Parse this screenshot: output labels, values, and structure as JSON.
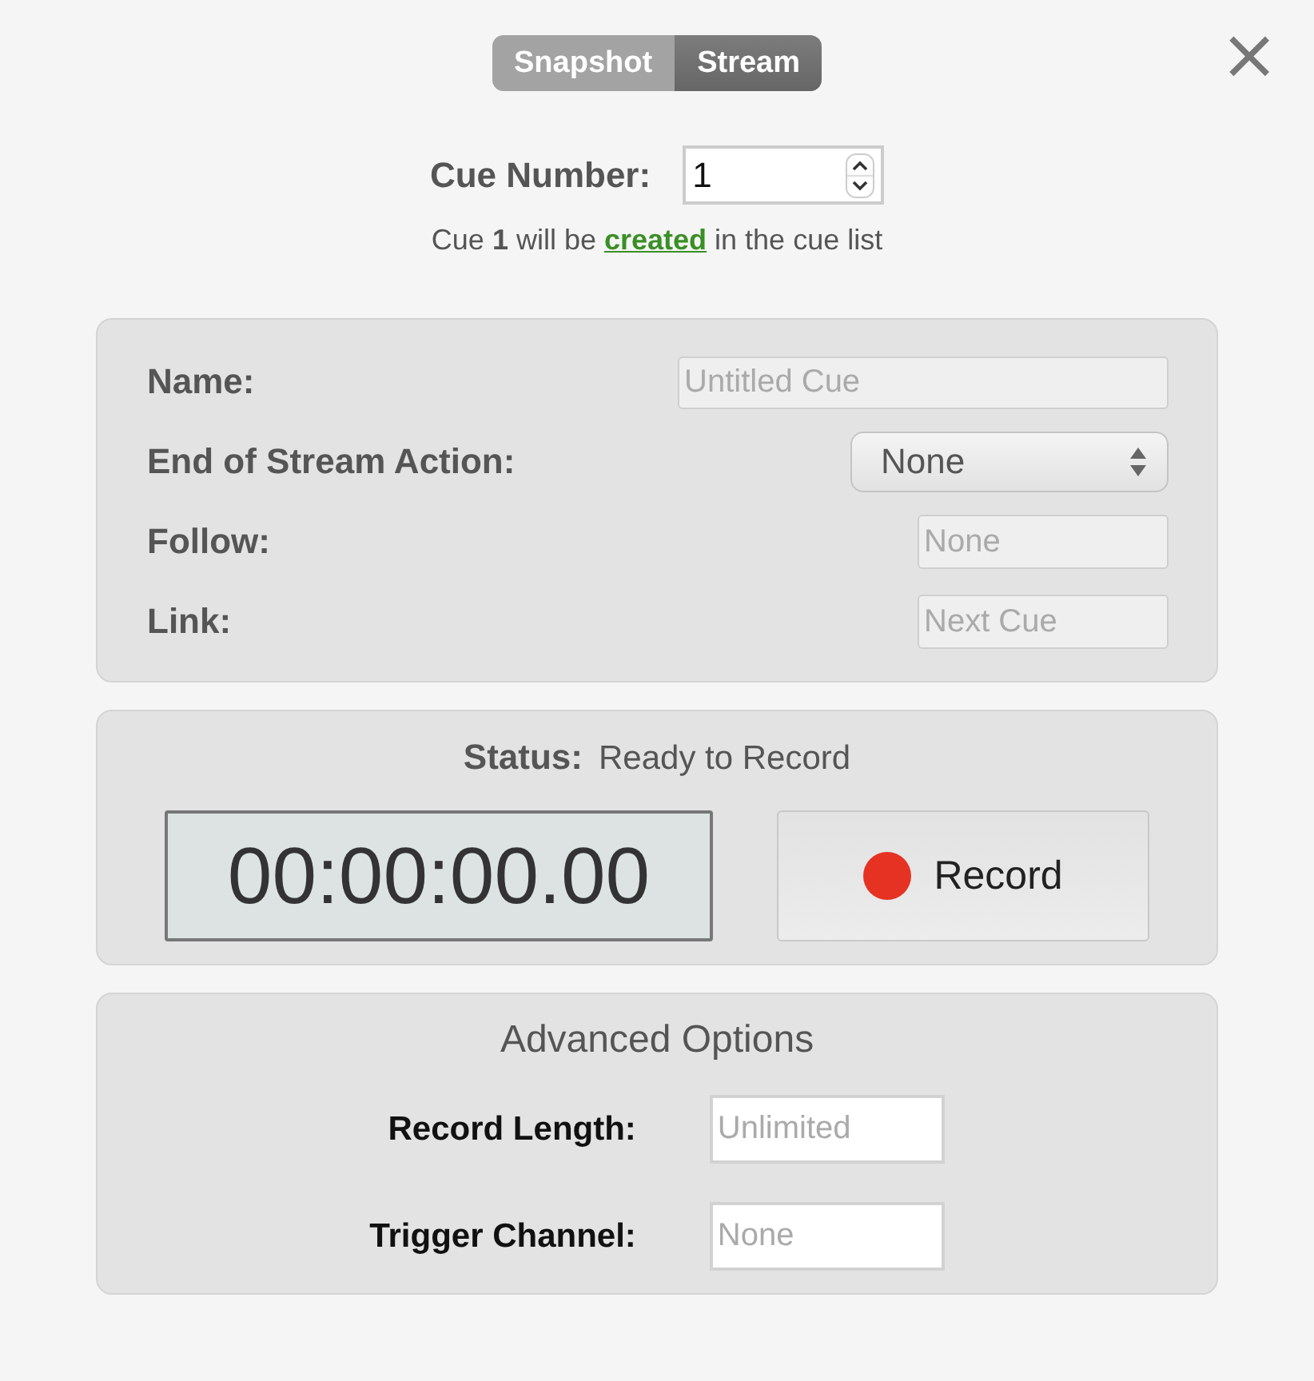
{
  "mode_tabs": [
    {
      "label": "Snapshot",
      "selected": false
    },
    {
      "label": "Stream",
      "selected": true
    }
  ],
  "close_button": {
    "symbol": "×"
  },
  "cue_number": {
    "label": "Cue Number:",
    "value": "1"
  },
  "cue_note": {
    "before": "Cue **1** will be",
    "link": "created",
    "after": "in the cue list"
  },
  "cue_fields": [
    {
      "kind": "wide_text",
      "label": "Name:",
      "placeholder": "Untitled Cue"
    },
    {
      "kind": "popup",
      "label": "End of Stream Action:",
      "value": "None"
    },
    {
      "kind": "text",
      "label": "Follow:",
      "placeholder": "None"
    },
    {
      "kind": "text",
      "label": "Link:",
      "placeholder": "Next Cue"
    }
  ],
  "status": {
    "label": "Status:",
    "value": "Ready to Record",
    "timer": "00:00:00.00",
    "record_button": "Record"
  },
  "advanced_options": {
    "title": "Advanced Options",
    "fields": [
      {
        "label": "Record Length:",
        "placeholder": "Unlimited"
      },
      {
        "label": "Trigger Channel:",
        "placeholder": "None"
      }
    ]
  }
}
